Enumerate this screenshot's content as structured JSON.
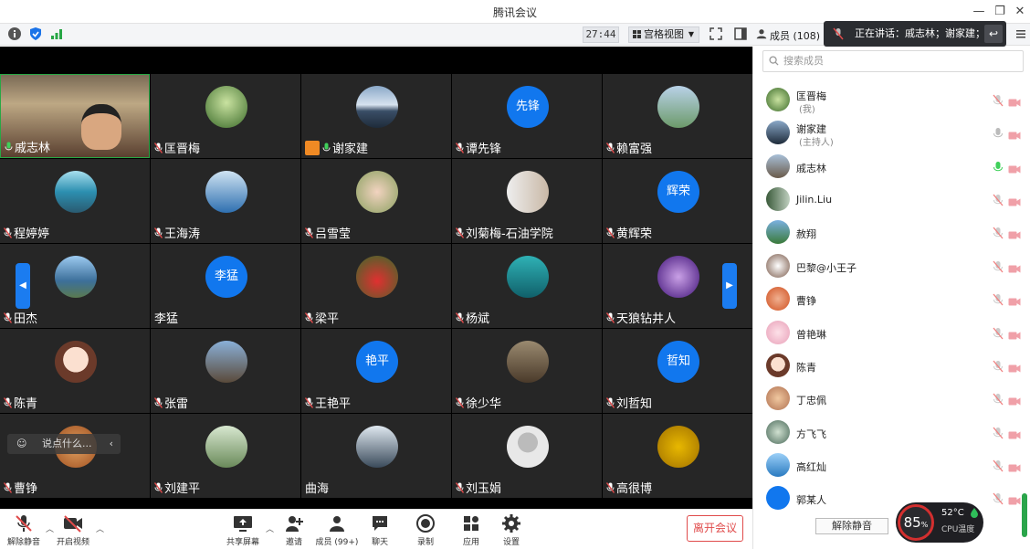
{
  "window": {
    "title": "腾讯会议"
  },
  "toolbar": {
    "timer": "27:44",
    "view_label": "宫格视图",
    "members_label": "成员 (108)"
  },
  "speaking_banner": {
    "text": "正在讲话：戚志林；谢家建；"
  },
  "colors": {
    "accent": "#1177ee",
    "speaker_border": "#29a745",
    "leave_red": "#e04b4b"
  },
  "tiles": [
    {
      "name": "戚志林",
      "avatar_text": ""
    },
    {
      "name": "匡晋梅",
      "avatar_text": ""
    },
    {
      "name": "谢家建",
      "avatar_text": ""
    },
    {
      "name": "谭先锋",
      "avatar_text": "先锋"
    },
    {
      "name": "赖富强",
      "avatar_text": ""
    },
    {
      "name": "程婷婷",
      "avatar_text": ""
    },
    {
      "name": "王海涛",
      "avatar_text": ""
    },
    {
      "name": "吕雪莹",
      "avatar_text": ""
    },
    {
      "name": "刘菊梅-石油学院",
      "avatar_text": ""
    },
    {
      "name": "黄辉荣",
      "avatar_text": "辉荣"
    },
    {
      "name": "田杰",
      "avatar_text": ""
    },
    {
      "name": "李猛",
      "avatar_text": "李猛"
    },
    {
      "name": "梁平",
      "avatar_text": ""
    },
    {
      "name": "杨斌",
      "avatar_text": ""
    },
    {
      "name": "天狼钻井人",
      "avatar_text": ""
    },
    {
      "name": "陈青",
      "avatar_text": ""
    },
    {
      "name": "张雷",
      "avatar_text": ""
    },
    {
      "name": "王艳平",
      "avatar_text": "艳平"
    },
    {
      "name": "徐少华",
      "avatar_text": ""
    },
    {
      "name": "刘哲知",
      "avatar_text": "哲知"
    },
    {
      "name": "曹铮",
      "avatar_text": ""
    },
    {
      "name": "刘建平",
      "avatar_text": ""
    },
    {
      "name": "曲海",
      "avatar_text": ""
    },
    {
      "name": "刘玉娟",
      "avatar_text": ""
    },
    {
      "name": "高很博",
      "avatar_text": ""
    }
  ],
  "say_bar": {
    "placeholder": "说点什么..."
  },
  "bottom": {
    "unmute": "解除静音",
    "start_video": "开启视频",
    "share": "共享屏幕",
    "invite": "邀请",
    "members": "成员 (99+)",
    "chat": "聊天",
    "record": "录制",
    "apps": "应用",
    "settings": "设置",
    "leave": "离开会议"
  },
  "panel": {
    "search_placeholder": "搜索成员",
    "members": [
      {
        "name": "匡晋梅",
        "role": "(我)"
      },
      {
        "name": "谢家建",
        "role": "(主持人)"
      },
      {
        "name": "戚志林",
        "role": ""
      },
      {
        "name": "Jilin.Liu",
        "role": ""
      },
      {
        "name": "赦翔",
        "role": ""
      },
      {
        "name": "巴黎@小王子",
        "role": ""
      },
      {
        "name": "曹铮",
        "role": ""
      },
      {
        "name": "曾艳琳",
        "role": ""
      },
      {
        "name": "陈青",
        "role": ""
      },
      {
        "name": "丁忠佩",
        "role": ""
      },
      {
        "name": "方飞飞",
        "role": ""
      },
      {
        "name": "高红灿",
        "role": ""
      },
      {
        "name": "郭某人",
        "role": ""
      }
    ],
    "unmute_all": "解除静音",
    "cpu_percent": "85",
    "cpu_percent_unit": "%",
    "cpu_temp": "52°C",
    "cpu_label": "CPU温度"
  }
}
